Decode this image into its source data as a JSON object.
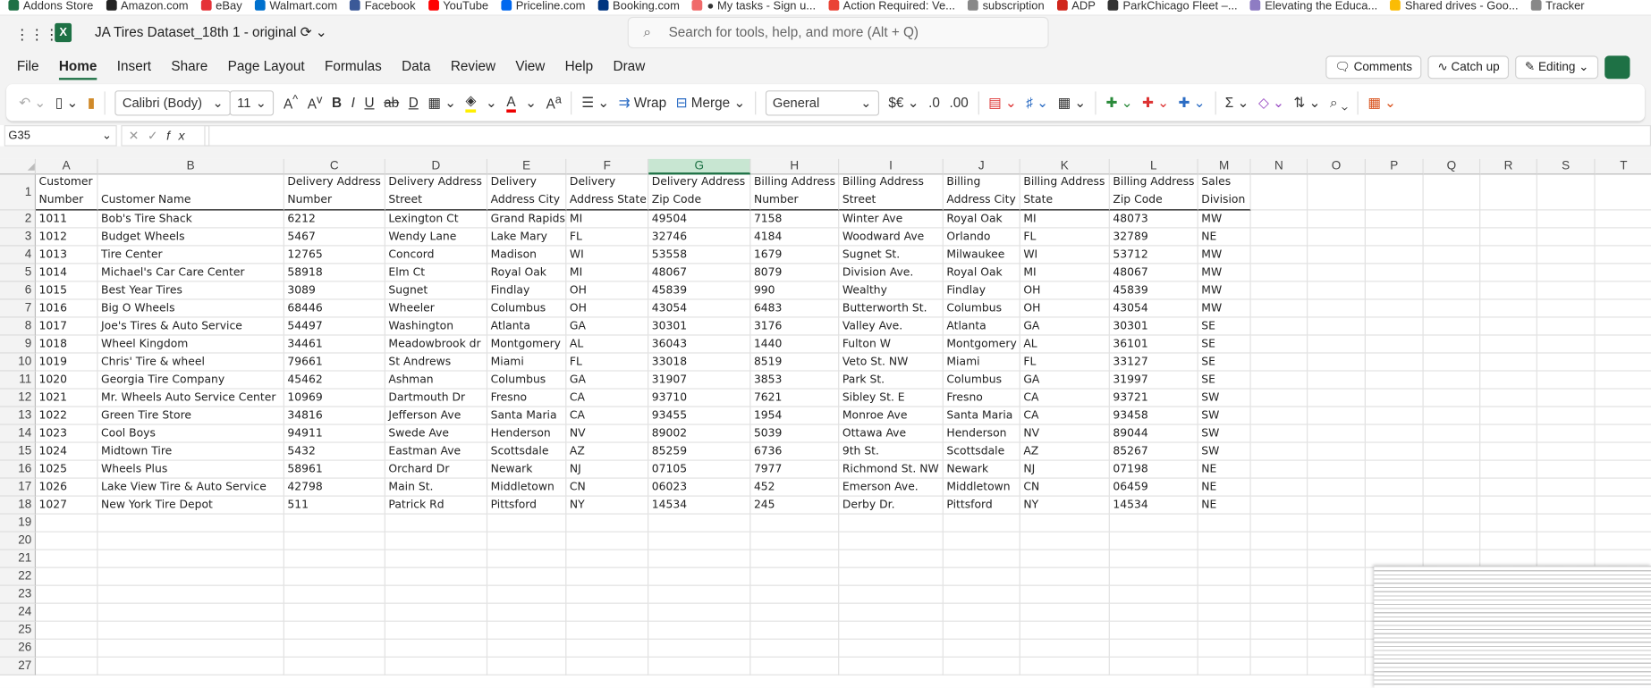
{
  "bookmarks": [
    {
      "label": "Addons Store",
      "color": "#1e7145"
    },
    {
      "label": "Amazon.com",
      "color": "#222222"
    },
    {
      "label": "eBay",
      "color": "#e53238"
    },
    {
      "label": "Walmart.com",
      "color": "#0071ce"
    },
    {
      "label": "Facebook",
      "color": "#3b5998"
    },
    {
      "label": "YouTube",
      "color": "#ff0000"
    },
    {
      "label": "Priceline.com",
      "color": "#0068ef"
    },
    {
      "label": "Booking.com",
      "color": "#003580"
    },
    {
      "label": "● My tasks - Sign u...",
      "color": "#f06a6a"
    },
    {
      "label": "Action Required: Ve...",
      "color": "#ea4335"
    },
    {
      "label": "subscription",
      "color": "#888888"
    },
    {
      "label": "ADP",
      "color": "#d0271d"
    },
    {
      "label": "ParkChicago Fleet –...",
      "color": "#333333"
    },
    {
      "label": "Elevating the Educa...",
      "color": "#8e7cc3"
    },
    {
      "label": "Shared drives - Goo...",
      "color": "#fbbc04"
    },
    {
      "label": "Tracker",
      "color": "#888888"
    }
  ],
  "app": {
    "title": "JA Tires Dataset_18th 1 - original",
    "search_placeholder": "Search for tools, help, and more (Alt + Q)",
    "accent": "#1e7145"
  },
  "tabs": [
    {
      "label": "File"
    },
    {
      "label": "Home",
      "active": true
    },
    {
      "label": "Insert"
    },
    {
      "label": "Share"
    },
    {
      "label": "Page Layout"
    },
    {
      "label": "Formulas"
    },
    {
      "label": "Data"
    },
    {
      "label": "Review"
    },
    {
      "label": "View"
    },
    {
      "label": "Help"
    },
    {
      "label": "Draw"
    }
  ],
  "actions": {
    "comments": "Comments",
    "catch_up": "Catch up",
    "editing": "Editing"
  },
  "ribbon": {
    "font": "Calibri (Body)",
    "size": "11",
    "wrap": "Wrap",
    "merge": "Merge",
    "number_format": "General",
    "currency": "$€"
  },
  "formula_bar": {
    "name_box": "G35",
    "fx": "fx",
    "value": ""
  },
  "selected_column": "G",
  "columns": [
    "A",
    "B",
    "C",
    "D",
    "E",
    "F",
    "G",
    "H",
    "I",
    "J",
    "K",
    "L",
    "M",
    "N",
    "O",
    "P",
    "Q",
    "R",
    "S",
    "T"
  ],
  "headers": [
    "Customer Number",
    "Customer Name",
    "Delivery Address Number",
    "Delivery Address Street",
    "Delivery Address City",
    "Delivery Address State",
    "Delivery Address Zip Code",
    "Billing Address Number",
    "Billing Address Street",
    "Billing Address City",
    "Billing Address State",
    "Billing Address Zip Code",
    "Sales Division"
  ],
  "rows": [
    [
      "1011",
      "Bob's Tire Shack",
      "6212",
      "Lexington Ct",
      "Grand Rapids",
      "MI",
      "49504",
      "7158",
      "Winter Ave",
      "Royal Oak",
      "MI",
      "48073",
      "MW"
    ],
    [
      "1012",
      "Budget Wheels",
      "5467",
      "Wendy Lane",
      "Lake Mary",
      "FL",
      "32746",
      "4184",
      "Woodward Ave",
      "Orlando",
      "FL",
      "32789",
      "NE"
    ],
    [
      "1013",
      "Tire Center",
      "12765",
      "Concord",
      "Madison",
      "WI",
      "53558",
      "1679",
      "Sugnet St.",
      "Milwaukee",
      "WI",
      "53712",
      "MW"
    ],
    [
      "1014",
      "Michael's Car Care Center",
      "58918",
      "Elm Ct",
      "Royal Oak",
      "MI",
      "48067",
      "8079",
      "Division Ave.",
      "Royal Oak",
      "MI",
      "48067",
      "MW"
    ],
    [
      "1015",
      "Best Year Tires",
      "3089",
      "Sugnet",
      "Findlay",
      "OH",
      "45839",
      "990",
      "Wealthy",
      "Findlay",
      "OH",
      "45839",
      "MW"
    ],
    [
      "1016",
      "Big O Wheels",
      "68446",
      "Wheeler",
      "Columbus",
      "OH",
      "43054",
      "6483",
      "Butterworth St.",
      "Columbus",
      "OH",
      "43054",
      "MW"
    ],
    [
      "1017",
      "Joe's Tires & Auto Service",
      "54497",
      "Washington",
      "Atlanta",
      "GA",
      "30301",
      "3176",
      "Valley Ave.",
      "Atlanta",
      "GA",
      "30301",
      "SE"
    ],
    [
      "1018",
      "Wheel Kingdom",
      "34461",
      "Meadowbrook dr",
      "Montgomery",
      "AL",
      "36043",
      "1440",
      "Fulton W",
      "Montgomery",
      "AL",
      "36101",
      "SE"
    ],
    [
      "1019",
      "Chris' Tire & wheel",
      "79661",
      "St Andrews",
      "Miami",
      "FL",
      "33018",
      "8519",
      "Veto St. NW",
      "Miami",
      "FL",
      "33127",
      "SE"
    ],
    [
      "1020",
      "Georgia Tire Company",
      "45462",
      "Ashman",
      "Columbus",
      "GA",
      "31907",
      "3853",
      "Park St.",
      "Columbus",
      "GA",
      "31997",
      "SE"
    ],
    [
      "1021",
      "Mr. Wheels Auto Service Center",
      "10969",
      "Dartmouth Dr",
      "Fresno",
      "CA",
      "93710",
      "7621",
      "Sibley St. E",
      "Fresno",
      "CA",
      "93721",
      "SW"
    ],
    [
      "1022",
      "Green Tire Store",
      "34816",
      "Jefferson Ave",
      "Santa Maria",
      "CA",
      "93455",
      "1954",
      "Monroe Ave",
      "Santa Maria",
      "CA",
      "93458",
      "SW"
    ],
    [
      "1023",
      "Cool Boys",
      "94911",
      "Swede Ave",
      "Henderson",
      "NV",
      "89002",
      "5039",
      "Ottawa Ave",
      "Henderson",
      "NV",
      "89044",
      "SW"
    ],
    [
      "1024",
      "Midtown Tire",
      "5432",
      "Eastman Ave",
      "Scottsdale",
      "AZ",
      "85259",
      "6736",
      "9th St.",
      "Scottsdale",
      "AZ",
      "85267",
      "SW"
    ],
    [
      "1025",
      "Wheels Plus",
      "58961",
      "Orchard Dr",
      "Newark",
      "NJ",
      "07105",
      "7977",
      "Richmond St. NW",
      "Newark",
      "NJ",
      "07198",
      "NE"
    ],
    [
      "1026",
      "Lake View Tire & Auto Service",
      "42798",
      "Main St.",
      "Middletown",
      "CN",
      "06023",
      "452",
      "Emerson Ave.",
      "Middletown",
      "CN",
      "06459",
      "NE"
    ],
    [
      "1027",
      "New York Tire Depot",
      "511",
      "Patrick Rd",
      "Pittsford",
      "NY",
      "14534",
      "245",
      "Derby Dr.",
      "Pittsford",
      "NY",
      "14534",
      "NE"
    ]
  ],
  "row_numbers": [
    "1",
    "2",
    "3",
    "4",
    "5",
    "6",
    "7",
    "8",
    "9",
    "10",
    "11",
    "12",
    "13",
    "14",
    "15",
    "16",
    "17",
    "18",
    "19",
    "20",
    "21",
    "22",
    "23",
    "24",
    "25",
    "26",
    "27"
  ]
}
